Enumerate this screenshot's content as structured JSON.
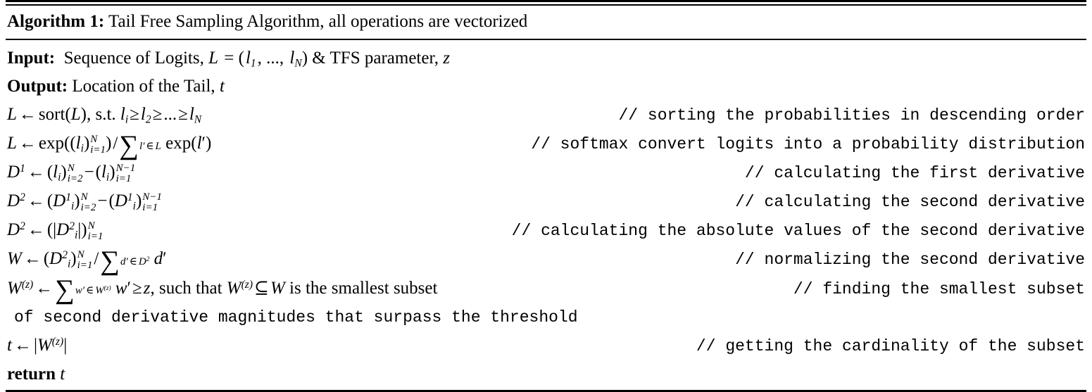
{
  "caption": {
    "label": "Algorithm 1:",
    "title": "Tail Free Sampling Algorithm, all operations are vectorized"
  },
  "io": {
    "input_label": "Input:",
    "input_text_a": "Sequence of Logits,",
    "input_L": "L",
    "input_eq": "= (",
    "input_l1": "l",
    "input_l1_sub": "1",
    "input_mid": ", ..., ",
    "input_lN": "l",
    "input_lN_sub": "N",
    "input_close": ")",
    "input_text_b": "& TFS parameter,",
    "input_z": "z",
    "output_label": "Output:",
    "output_text": "Location of the Tail,",
    "output_t": "t"
  },
  "lines": [
    {
      "id": "sort",
      "comment": "// sorting the probabilities in descending order"
    },
    {
      "id": "softmax",
      "comment": "// softmax convert logits into a probability distribution"
    },
    {
      "id": "first-derivative",
      "comment": "// calculating the first derivative"
    },
    {
      "id": "second-derivative",
      "comment": "// calculating the second derivative"
    },
    {
      "id": "absolute-values",
      "comment": "// calculating the absolute values of the second derivative"
    },
    {
      "id": "normalize",
      "comment": "// normalizing the second derivative"
    },
    {
      "id": "smallest-subset",
      "comment": "// finding the smallest subset",
      "comment_continued": " of second derivative magnitudes that surpass the threshold"
    },
    {
      "id": "cardinality",
      "comment": "// getting the cardinality of the subset"
    }
  ],
  "math": {
    "L": "L",
    "W": "W",
    "D": "D",
    "t": "t",
    "z": "z",
    "d": "d",
    "w": "w",
    "l": "l",
    "i": "i",
    "N": "N",
    "arrow": "←",
    "sort_fn": "sort",
    "exp_fn": "exp",
    "sum_sign": "∑",
    "ge": "≥",
    "subset_eq": "⊆",
    "in": "∈",
    "minus": "−",
    "slash": "/",
    "st": "s.t.",
    "dots": "...",
    "one": "1",
    "two": "2",
    "N_minus_1": "N−1",
    "i_eq_1": "i=1",
    "i_eq_2": "i=2",
    "such_that": ", such that",
    "is_smallest_subset": "is the smallest subset",
    "return_kw": "return"
  }
}
